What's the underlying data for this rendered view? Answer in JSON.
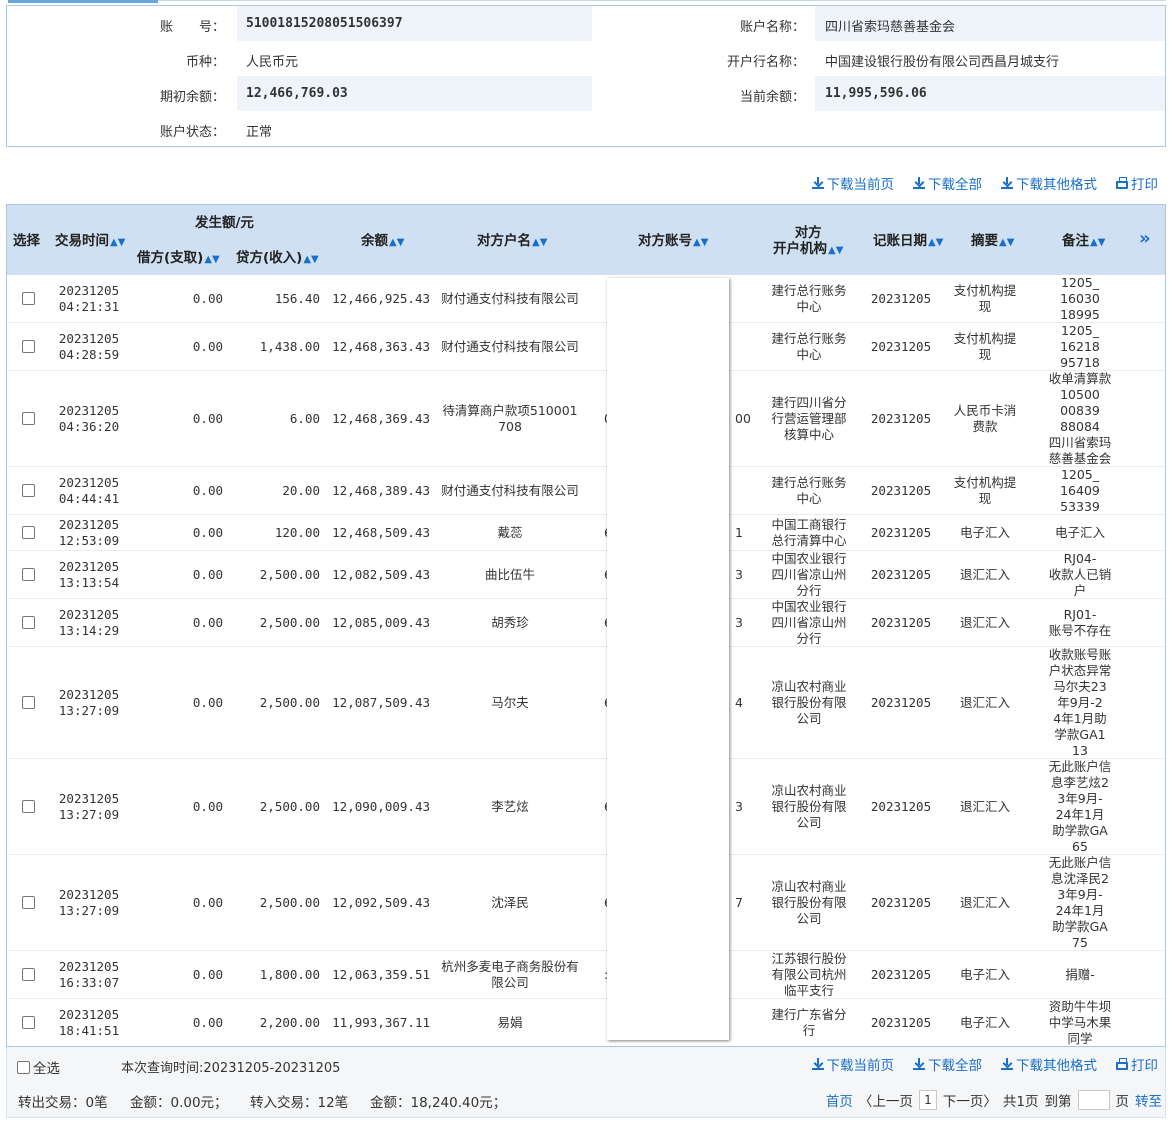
{
  "account": {
    "acct_no_label": "账　　号：",
    "acct_no": "51001815208051506397",
    "acct_name_label": "账户名称：",
    "acct_name": "四川省索玛慈善基金会",
    "currency_label": "币种：",
    "currency": "人民币元",
    "bank_label": "开户行名称：",
    "bank": "中国建设银行股份有限公司西昌月城支行",
    "opening_label": "期初余额：",
    "opening": "12,466,769.03",
    "current_label": "当前余额：",
    "current": "11,995,596.06",
    "status_label": "账户状态：",
    "status": "正常"
  },
  "toolbar": {
    "dl_page": "下载当前页",
    "dl_all": "下载全部",
    "dl_other": "下载其他格式",
    "print": "打印"
  },
  "table": {
    "headers": {
      "select": "选择",
      "time": "交易时间",
      "amount_group": "发生额/元",
      "debit": "借方(支取)",
      "credit": "贷方(收入)",
      "balance": "余额",
      "cp_name": "对方户名",
      "cp_acct": "对方账号",
      "cp_bank": "对方\n开户机构",
      "post_date": "记账日期",
      "summary": "摘要",
      "remark": "备注",
      "more": "»"
    },
    "sort_glyph": "▲▼",
    "rows": [
      {
        "date": "20231205",
        "time": "04:21:31",
        "debit": "0.00",
        "credit": "156.40",
        "balance": "12,466,925.43",
        "cp_name": "财付通支付科技有限公司",
        "cp_acct_l": "",
        "cp_acct_r": "",
        "cp_bank": "建行总行账务中心",
        "post": "20231205",
        "summary": "支付机构提现",
        "remark": "1205_\n16030\n18995"
      },
      {
        "date": "20231205",
        "time": "04:28:59",
        "debit": "0.00",
        "credit": "1,438.00",
        "balance": "12,468,363.43",
        "cp_name": "财付通支付科技有限公司",
        "cp_acct_l": "",
        "cp_acct_r": "",
        "cp_bank": "建行总行账务中心",
        "post": "20231205",
        "summary": "支付机构提现",
        "remark": "1205_\n16218\n95718"
      },
      {
        "date": "20231205",
        "time": "04:36:20",
        "debit": "0.00",
        "credit": "6.00",
        "balance": "12,468,369.43",
        "cp_name": "待清算商户款项510001708",
        "cp_acct_l": "0",
        "cp_acct_r": "00",
        "cp_bank": "建行四川省分行营运管理部核算中心",
        "post": "20231205",
        "summary": "人民币卡消费款",
        "remark": "收单清算款\n10500\n00839\n88084\n四川省索玛\n慈善基金会"
      },
      {
        "date": "20231205",
        "time": "04:44:41",
        "debit": "0.00",
        "credit": "20.00",
        "balance": "12,468,389.43",
        "cp_name": "财付通支付科技有限公司",
        "cp_acct_l": "",
        "cp_acct_r": "",
        "cp_bank": "建行总行账务中心",
        "post": "20231205",
        "summary": "支付机构提现",
        "remark": "1205_\n16409\n53339"
      },
      {
        "date": "20231205",
        "time": "12:53:09",
        "debit": "0.00",
        "credit": "120.00",
        "balance": "12,468,509.43",
        "cp_name": "戴蕊",
        "cp_acct_l": "6:",
        "cp_acct_r": "1",
        "cp_bank": "中国工商银行总行清算中心",
        "post": "20231205",
        "summary": "电子汇入",
        "remark": "电子汇入"
      },
      {
        "date": "20231205",
        "time": "13:13:54",
        "debit": "0.00",
        "credit": "2,500.00",
        "balance": "12,082,509.43",
        "cp_name": "曲比伍牛",
        "cp_acct_l": "6:",
        "cp_acct_r": "3",
        "cp_bank": "中国农业银行四川省凉山州分行",
        "post": "20231205",
        "summary": "退汇汇入",
        "remark": "RJ04-\n收款人已销\n户"
      },
      {
        "date": "20231205",
        "time": "13:14:29",
        "debit": "0.00",
        "credit": "2,500.00",
        "balance": "12,085,009.43",
        "cp_name": "胡秀珍",
        "cp_acct_l": "6:",
        "cp_acct_r": "3",
        "cp_bank": "中国农业银行四川省凉山州分行",
        "post": "20231205",
        "summary": "退汇汇入",
        "remark": "RJ01-\n账号不存在"
      },
      {
        "date": "20231205",
        "time": "13:27:09",
        "debit": "0.00",
        "credit": "2,500.00",
        "balance": "12,087,509.43",
        "cp_name": "马尔夫",
        "cp_acct_l": "6:",
        "cp_acct_r": "4",
        "cp_bank": "凉山农村商业银行股份有限公司",
        "post": "20231205",
        "summary": "退汇汇入",
        "remark": "收款账号账\n户状态异常\n马尔夫23\n年9月-2\n4年1月助\n学款GA1\n13"
      },
      {
        "date": "20231205",
        "time": "13:27:09",
        "debit": "0.00",
        "credit": "2,500.00",
        "balance": "12,090,009.43",
        "cp_name": "李艺炫",
        "cp_acct_l": "6:",
        "cp_acct_r": "3",
        "cp_bank": "凉山农村商业银行股份有限公司",
        "post": "20231205",
        "summary": "退汇汇入",
        "remark": "无此账户信\n息李艺炫2\n3年9月-\n24年1月\n助学款GA\n65"
      },
      {
        "date": "20231205",
        "time": "13:27:09",
        "debit": "0.00",
        "credit": "2,500.00",
        "balance": "12,092,509.43",
        "cp_name": "沈泽民",
        "cp_acct_l": "6:",
        "cp_acct_r": "7",
        "cp_bank": "凉山农村商业银行股份有限公司",
        "post": "20231205",
        "summary": "退汇汇入",
        "remark": "无此账户信\n息沈泽民2\n3年9月-\n24年1月\n助学款GA\n75"
      },
      {
        "date": "20231205",
        "time": "16:33:07",
        "debit": "0.00",
        "credit": "1,800.00",
        "balance": "12,063,359.51",
        "cp_name": "杭州多麦电子商务股份有限公司",
        "cp_acct_l": ":",
        "cp_acct_r": "",
        "cp_bank": "江苏银行股份有限公司杭州临平支行",
        "post": "20231205",
        "summary": "电子汇入",
        "remark": "捐赠-"
      },
      {
        "date": "20231205",
        "time": "18:41:51",
        "debit": "0.00",
        "credit": "2,200.00",
        "balance": "11,993,367.11",
        "cp_name": "易娟",
        "cp_acct_l": "",
        "cp_acct_r": "",
        "cp_bank": "建行广东省分行",
        "post": "20231205",
        "summary": "电子汇入",
        "remark": "资助牛牛坝\n中学马木果\n同学"
      }
    ]
  },
  "footer": {
    "select_all": "全选",
    "query_time": "本次查询时间:20231205-20231205",
    "out_tx": "转出交易：0笔",
    "out_amt": "金额：0.00元；",
    "in_tx": "转入交易：12笔",
    "in_amt": "金额：18,240.40元；",
    "first": "首页",
    "prev": "〈上一页",
    "page_no": "1",
    "next": "下一页〉",
    "total": "共1页",
    "goto": "到第",
    "page_unit": "页",
    "go": "转至"
  }
}
